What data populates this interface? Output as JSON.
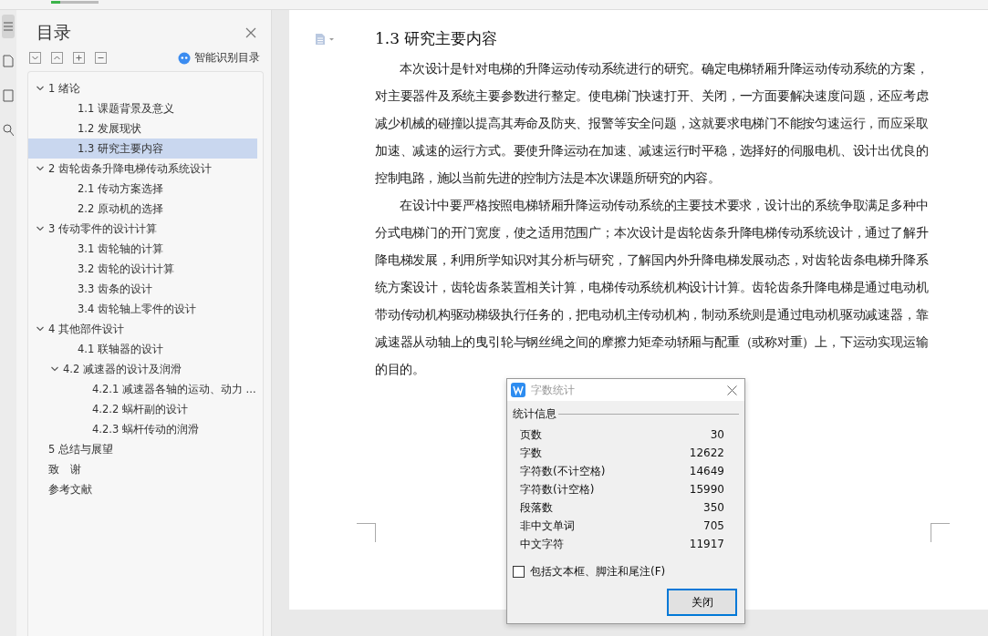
{
  "progress": {
    "level": 0.2
  },
  "sidebar": {
    "title": "目录",
    "smart_button": "智能识别目录",
    "tree": [
      {
        "label": "1 绪论",
        "expanded": true,
        "selected": false,
        "children": [
          {
            "label": "1.1 课题背景及意义",
            "selected": false
          },
          {
            "label": "1.2 发展现状",
            "selected": false
          },
          {
            "label": "1.3 研究主要内容",
            "selected": true
          }
        ]
      },
      {
        "label": "2 齿轮齿条升降电梯传动系统设计",
        "expanded": true,
        "selected": false,
        "children": [
          {
            "label": "2.1 传动方案选择",
            "selected": false
          },
          {
            "label": "2.2 原动机的选择",
            "selected": false
          }
        ]
      },
      {
        "label": "3 传动零件的设计计算",
        "expanded": true,
        "selected": false,
        "children": [
          {
            "label": "3.1 齿轮轴的计算",
            "selected": false
          },
          {
            "label": "3.2 齿轮的设计计算",
            "selected": false
          },
          {
            "label": "3.3 齿条的设计",
            "selected": false
          },
          {
            "label": "3.4 齿轮轴上零件的设计",
            "selected": false
          }
        ]
      },
      {
        "label": "4 其他部件设计",
        "expanded": true,
        "selected": false,
        "children": [
          {
            "label": "4.1 联轴器的设计",
            "selected": false
          },
          {
            "label": "4.2 减速器的设计及润滑",
            "expanded": true,
            "selected": false,
            "children": [
              {
                "label": "4.2.1 减速器各轴的运动、动力 ...",
                "selected": false
              },
              {
                "label": "4.2.2 蜗杆副的设计",
                "selected": false
              },
              {
                "label": "4.2.3 蜗杆传动的润滑",
                "selected": false
              }
            ]
          }
        ]
      },
      {
        "label": "5 总结与展望",
        "selected": false
      },
      {
        "label": "致　谢",
        "selected": false
      },
      {
        "label": "参考文献",
        "selected": false
      }
    ]
  },
  "document": {
    "heading": "1.3 研究主要内容",
    "paragraphs": [
      "本次设计是针对电梯的升降运动传动系统进行的研究。确定电梯轿厢升降运动传动系统的方案，对主要器件及系统主要参数进行整定。使电梯门快速打开、关闭，一方面要解决速度问题，还应考虑减少机械的碰撞以提高其寿命及防夹、报警等安全问题，这就要求电梯门不能按匀速运行，而应采取加速、减速的运行方式。要使升降运动在加速、减速运行时平稳，选择好的伺服电机、设计出优良的控制电路，施以当前先进的控制方法是本次课题所研究的内容。",
      "在设计中要严格按照电梯轿厢升降运动传动系统的主要技术要求，设计出的系统争取满足多种中分式电梯门的开门宽度，使之适用范围广；本次设计是齿轮齿条升降电梯传动系统设计，通过了解升降电梯发展，利用所学知识对其分析与研究，了解国内外升降电梯发展动态，对齿轮齿条电梯升降系统方案设计，齿轮齿条装置相关计算，电梯传动系统机构设计计算。齿轮齿条升降电梯是通过电动机带动传动机构驱动梯级执行任务的，把电动机主传动机构，制动系统则是通过电动机驱动减速器，靠减速器从动轴上的曳引轮与钢丝绳之间的摩擦力矩牵动轿厢与配重（或称对重）上，下运动实现运输的目的。"
    ]
  },
  "dialog": {
    "title": "字数统计",
    "group": "统计信息",
    "rows": [
      {
        "label": "页数",
        "value": "30"
      },
      {
        "label": "字数",
        "value": "12622"
      },
      {
        "label": "字符数(不计空格)",
        "value": "14649"
      },
      {
        "label": "字符数(计空格)",
        "value": "15990"
      },
      {
        "label": "段落数",
        "value": "350"
      },
      {
        "label": "非中文单词",
        "value": "705"
      },
      {
        "label": "中文字符",
        "value": "11917"
      }
    ],
    "checkbox": {
      "label": "包括文本框、脚注和尾注(F)",
      "checked": false
    },
    "button": "关闭"
  }
}
